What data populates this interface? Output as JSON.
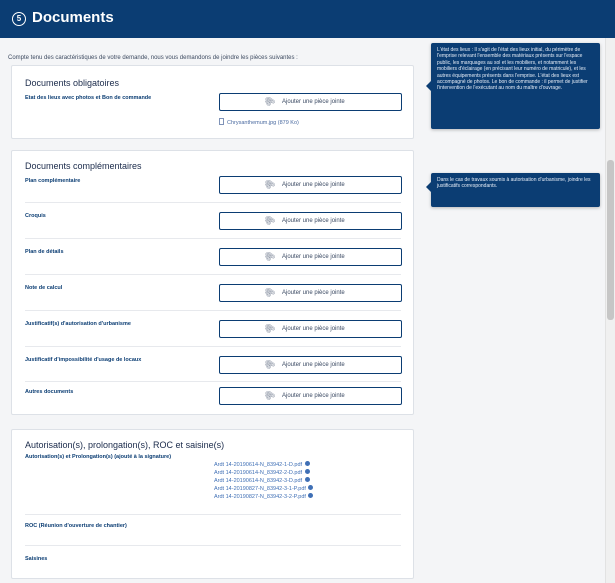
{
  "header": {
    "step_number": "5",
    "title": "Documents"
  },
  "intro_text": "Compte tenu des caractéristiques de votre demande, nous vous demandons de joindre les pièces suivantes :",
  "attach_label": "Ajouter une pièce jointe",
  "obligatoires": {
    "title": "Documents obligatoires",
    "item_label": "Etat des lieux avec photos et Bon de commande",
    "file": "Chrysanthemum.jpg (879 Ko)"
  },
  "complementaires": {
    "title": "Documents complémentaires",
    "items": [
      {
        "label": "Plan complémentaire"
      },
      {
        "label": "Croquis"
      },
      {
        "label": "Plan de détails"
      },
      {
        "label": "Note de calcul"
      },
      {
        "label": "Justificatif(s) d'autorisation d'urbanisme"
      },
      {
        "label": "Justificatif d'impossibilité d'usage de locaux"
      },
      {
        "label": "Autres documents"
      }
    ]
  },
  "autorisations": {
    "title": "Autorisation(s), prolongation(s), ROC et saisine(s)",
    "item1_label": "Autorisation(s) et Prolongation(s) (ajouté à la signature)",
    "files": [
      "Ardt 14-20190614-N_83942-1-D.pdf",
      "Ardt 14-20190614-N_83942-2-D.pdf",
      "Ardt 14-20190614-N_83942-3-D.pdf",
      "Ardt 14-20190827-N_83942-3-1-P.pdf",
      "Ardt 14-20190827-N_83942-3-2-P.pdf"
    ],
    "item2_label": "ROC (Réunion d'ouverture de chantier)",
    "item3_label": "Saisines"
  },
  "tooltips": {
    "etat_des_lieux": "L'état des lieux : Il s'agit de l'état des lieux initial, du périmètre de l'emprise relevant l'ensemble des matériaux présents sur l'espace public, les marquages au sol et les mobiliers, et notamment les mobiliers d'éclairage (en précisant leur numéro de matricule), et les autres équipements présents dans l'emprise. L'état des lieux est accompagné de photos. Le bon de commande : il permet de justifier l'intervention de l'exécutant au nom du maître d'ouvrage.",
    "urbanisme": "Dans le cas de travaux soumis à autorisation d'urbanisme, joindre les justificatifs correspondants."
  },
  "colors": {
    "primary": "#0b3d73",
    "link": "#3f6fb5",
    "background": "#f4f5f7"
  }
}
